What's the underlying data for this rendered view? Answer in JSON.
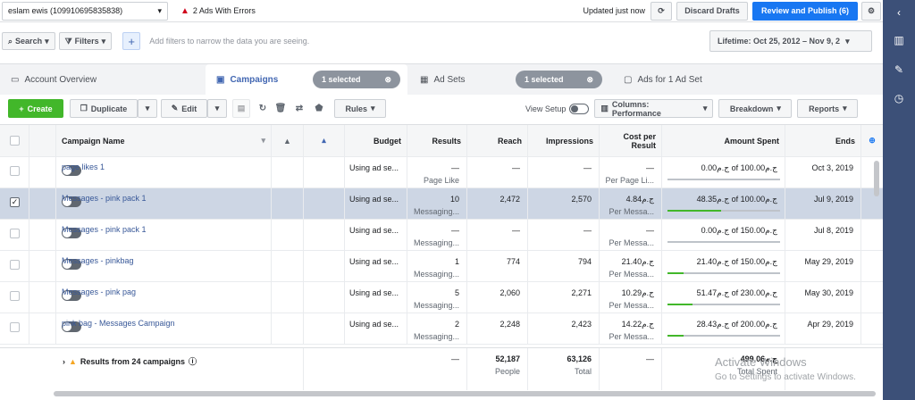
{
  "topbar": {
    "account": "eslam ewis (109910695835838)",
    "errors": "2 Ads With Errors",
    "updated": "Updated just now",
    "discard": "Discard Drafts",
    "review": "Review and Publish (6)"
  },
  "filterbar": {
    "search": "Search",
    "filters": "Filters",
    "placeholder": "Add filters to narrow the data you are seeing.",
    "lifetime": "Lifetime: Oct 25, 2012 – Nov 9, 2"
  },
  "tabs": {
    "account_overview": "Account Overview",
    "campaigns": "Campaigns",
    "campaigns_selected": "1 selected",
    "ad_sets": "Ad Sets",
    "ad_sets_selected": "1 selected",
    "ads": "Ads for 1 Ad Set"
  },
  "toolbar": {
    "create": "Create",
    "duplicate": "Duplicate",
    "edit": "Edit",
    "rules": "Rules",
    "view_setup": "View Setup",
    "columns": "Columns: Performance",
    "breakdown": "Breakdown",
    "reports": "Reports"
  },
  "headers": {
    "name": "Campaign Name",
    "budget": "Budget",
    "results": "Results",
    "reach": "Reach",
    "impressions": "Impressions",
    "cpr1": "Cost per",
    "cpr2": "Result",
    "spent": "Amount Spent",
    "ends": "Ends"
  },
  "rows": [
    {
      "name": "page likes 1",
      "budget": "Using ad se...",
      "results": "—",
      "results_sub": "Page Like",
      "reach": "—",
      "impr": "—",
      "cpr": "—",
      "cpr_sub": "Per Page Li...",
      "spent": "0.00ج.م of 100.00ج.م",
      "pct": 0.0,
      "ends": "Oct 3, 2019"
    },
    {
      "name": "Messages - pink pack 1",
      "budget": "Using ad se...",
      "results": "10",
      "results_sub": "Messaging...",
      "reach": "2,472",
      "impr": "2,570",
      "cpr": "4.84ج.م",
      "cpr_sub": "Per Messa...",
      "spent": "48.35ج.م of 100.00ج.م",
      "pct": 0.48,
      "ends": "Jul 9, 2019"
    },
    {
      "name": "Messages - pink pack 1",
      "budget": "Using ad se...",
      "results": "—",
      "results_sub": "Messaging...",
      "reach": "—",
      "impr": "—",
      "cpr": "—",
      "cpr_sub": "Per Messa...",
      "spent": "0.00ج.م of 150.00ج.م",
      "pct": 0.0,
      "ends": "Jul 8, 2019"
    },
    {
      "name": "Messages - pinkbag",
      "budget": "Using ad se...",
      "results": "1",
      "results_sub": "Messaging...",
      "reach": "774",
      "impr": "794",
      "cpr": "21.40ج.م",
      "cpr_sub": "Per Messa...",
      "spent": "21.40ج.م of 150.00ج.م",
      "pct": 0.14,
      "ends": "May 29, 2019"
    },
    {
      "name": "Messages - pink pag",
      "budget": "Using ad se...",
      "results": "5",
      "results_sub": "Messaging...",
      "reach": "2,060",
      "impr": "2,271",
      "cpr": "10.29ج.م",
      "cpr_sub": "Per Messa...",
      "spent": "51.47ج.م of 230.00ج.م",
      "pct": 0.22,
      "ends": "May 30, 2019"
    },
    {
      "name": "pink bag - Messages Campaign",
      "budget": "Using ad se...",
      "results": "2",
      "results_sub": "Messaging...",
      "reach": "2,248",
      "impr": "2,423",
      "cpr": "14.22ج.م",
      "cpr_sub": "Per Messa...",
      "spent": "28.43ج.م of 200.00ج.م",
      "pct": 0.14,
      "ends": "Apr 29, 2019"
    }
  ],
  "footer": {
    "label": "Results from 24 campaigns",
    "results": "—",
    "reach": "52,187",
    "reach_sub": "People",
    "impr": "63,126",
    "impr_sub": "Total",
    "cpr": "—",
    "spent": "499.06ج.م",
    "spent_sub": "Total Spent"
  },
  "watermark": {
    "line1": "Activate Windows",
    "line2": "Go to Settings to activate Windows."
  }
}
